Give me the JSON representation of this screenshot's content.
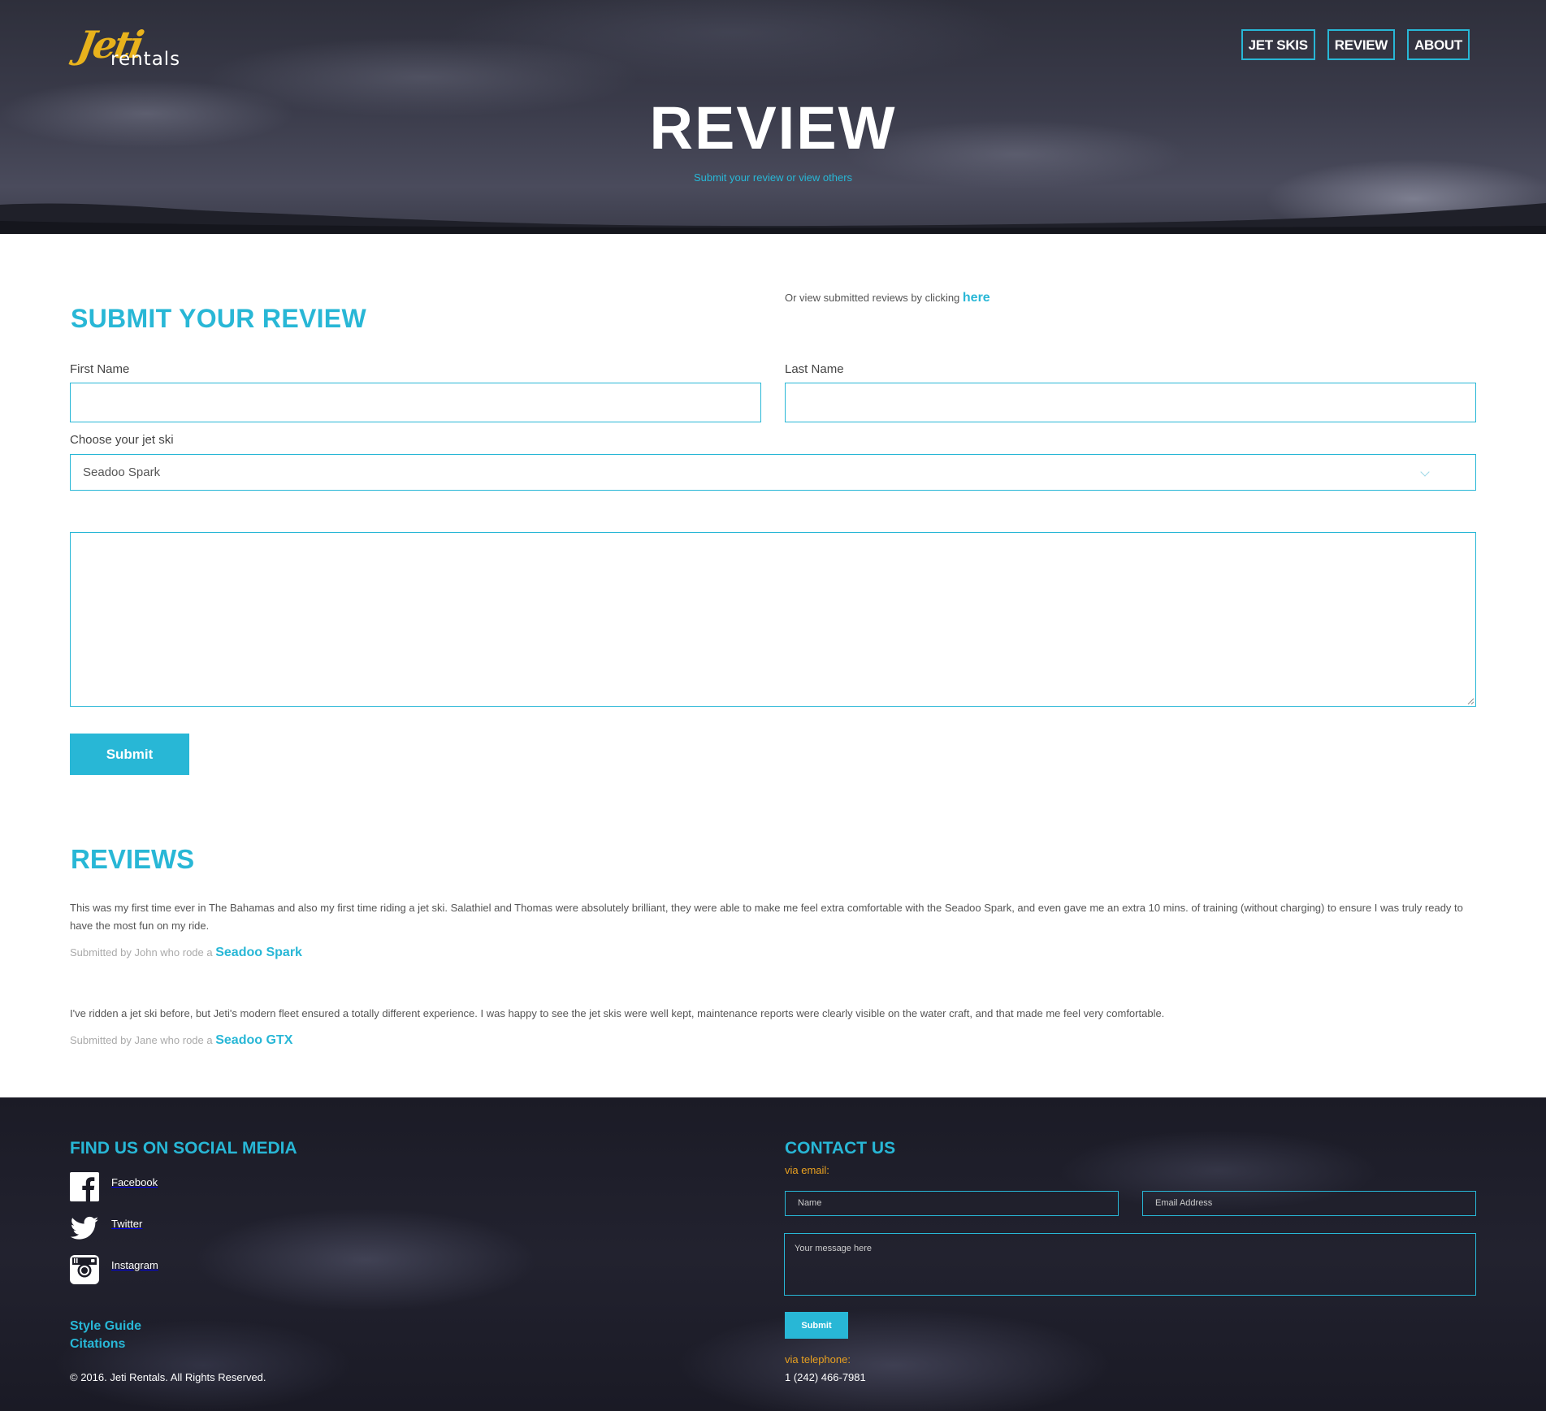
{
  "header": {
    "logo_text": "Jeti",
    "logo_sub": "rentals",
    "nav": [
      "JET SKIS",
      "REVIEW",
      "ABOUT"
    ],
    "title": "REVIEW",
    "subtitle": "Submit your review or view others"
  },
  "form": {
    "heading": "SUBMIT YOUR REVIEW",
    "view_prefix": "Or view submitted reviews by clicking ",
    "view_link": "here",
    "first_name_label": "First Name",
    "first_name_value": "",
    "last_name_label": "Last Name",
    "last_name_value": "",
    "jetski_label": "Choose your jet ski",
    "jetski_selected": "Seadoo Spark",
    "review_value": "",
    "submit_label": "Submit"
  },
  "reviews": {
    "heading": "REVIEWS",
    "items": [
      {
        "text": "This was my first time ever in The Bahamas and also my first time riding a jet ski. Salathiel and Thomas were absolutely brilliant, they were able to make me feel extra comfortable with the Seadoo Spark, and even gave me an extra 10 mins. of training (without charging) to ensure I was truly ready to have the most fun on my ride.",
        "by": "Submitted by John who rode a ",
        "ski": "Seadoo Spark"
      },
      {
        "text": "I've ridden a jet ski before, but Jeti's modern fleet ensured a totally different experience. I was happy to see the jet skis were well kept, maintenance reports were clearly visible on the water craft, and that made me feel very comfortable.",
        "by": "Submitted by Jane who rode a ",
        "ski": "Seadoo GTX"
      }
    ]
  },
  "footer": {
    "social_heading": "FIND US ON SOCIAL MEDIA",
    "social": [
      "Facebook",
      "Twitter",
      "Instagram"
    ],
    "style_guide": "Style Guide",
    "citations": "Citations",
    "copyright": "© 2016. Jeti Rentals. All Rights Reserved.",
    "contact_heading": "CONTACT US",
    "via_email": "via email:",
    "name_placeholder": "Name",
    "email_placeholder": "Email Address",
    "message_placeholder": "Your message here",
    "submit_label": "Submit",
    "via_phone": "via telephone:",
    "phone": "1 (242) 466-7981"
  },
  "colors": {
    "accent": "#28b7d6",
    "logo_yellow": "#e8b21c",
    "orange": "#e8a020",
    "footer_bg": "#1b1b26"
  }
}
